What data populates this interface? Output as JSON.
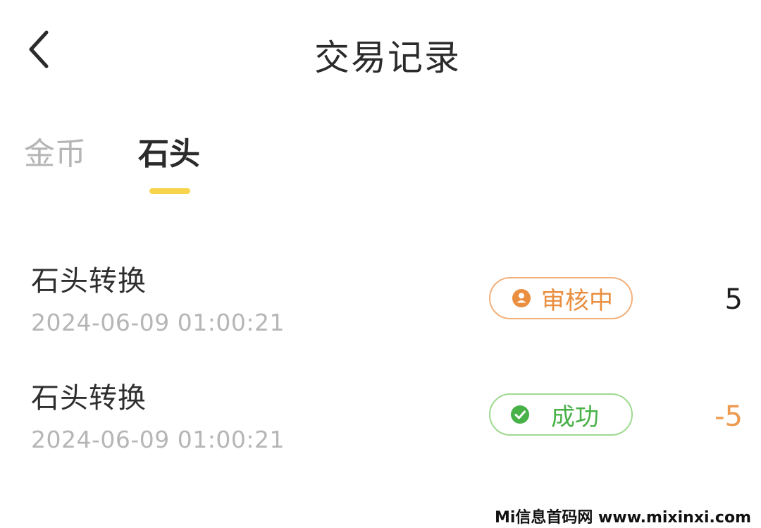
{
  "header": {
    "title": "交易记录",
    "back_icon": "chevron-left-icon"
  },
  "tabs": [
    {
      "label": "金币",
      "active": false
    },
    {
      "label": "石头",
      "active": true
    }
  ],
  "colors": {
    "indicator": "#f7d44c",
    "review": "#e98f3f",
    "success": "#48b148",
    "negative_amount": "#ec9a4f"
  },
  "records": [
    {
      "title": "石头转换",
      "time": "2024-06-09 01:00:21",
      "status": "审核中",
      "status_icon": "pending-user-icon",
      "amount": "5"
    },
    {
      "title": "石头转换",
      "time": "2024-06-09 01:00:21",
      "status": "成功",
      "status_icon": "check-circle-icon",
      "amount": "-5"
    }
  ],
  "watermark": "Mi信息首码网 www.mixinxi.com"
}
